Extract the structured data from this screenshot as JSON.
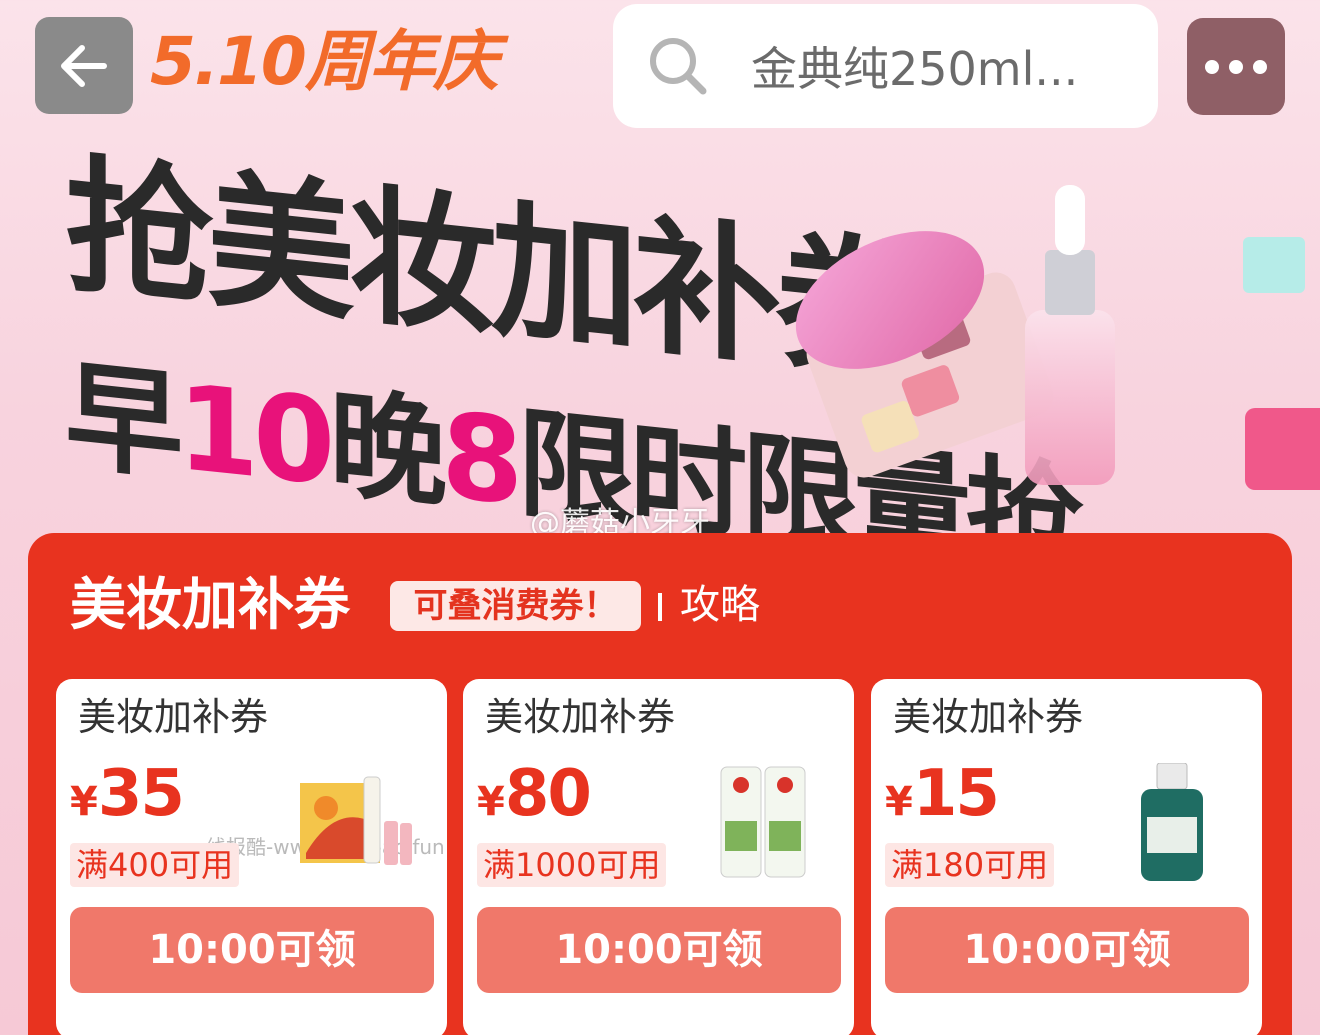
{
  "header": {
    "brand": "5.10周年庆",
    "search_placeholder": "金典纯250ml..."
  },
  "hero": {
    "line1": "抢美妆加补券",
    "line2_a": "早",
    "line2_b": "10",
    "line2_c": "晚",
    "line2_d": "8",
    "line2_e": "限时限量抢",
    "watermark": "@蘑菇小牙牙"
  },
  "panel": {
    "title": "美妆加补券",
    "badge": "可叠消费券！",
    "link": "攻略",
    "card_watermark": "线报酷-www.xianbao.fun",
    "coupons": [
      {
        "title": "美妆加补券",
        "yen": "¥",
        "amount": "35",
        "condition": "满400可用",
        "button": "10:00可领",
        "product_icon": "gift-set-icon"
      },
      {
        "title": "美妆加补券",
        "yen": "¥",
        "amount": "80",
        "condition": "满1000可用",
        "button": "10:00可领",
        "product_icon": "toothpaste-icon"
      },
      {
        "title": "美妆加补券",
        "yen": "¥",
        "amount": "15",
        "condition": "满180可用",
        "button": "10:00可领",
        "product_icon": "bottle-icon"
      }
    ]
  },
  "colors": {
    "brand_orange": "#f26b2a",
    "panel_red": "#e8331f",
    "button_salmon": "#f0786a",
    "hero_pink": "#e8127a"
  }
}
